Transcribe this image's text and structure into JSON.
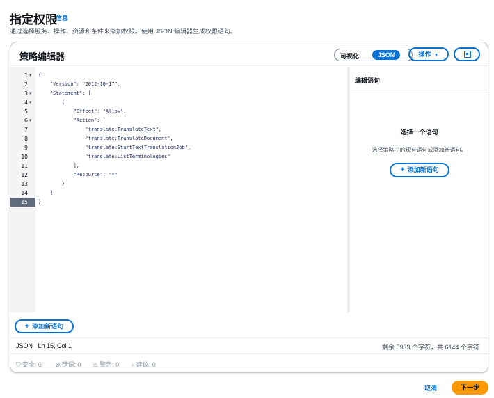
{
  "page": {
    "title": "指定权限",
    "info_link": "信息",
    "description": "通过选择服务、操作、资源和条件来添加权限。使用 JSON 编辑器生成权限语句。"
  },
  "editor_panel": {
    "title": "策略编辑器",
    "toggle": {
      "visual": "可视化",
      "json": "JSON",
      "selected": "JSON"
    },
    "actions_label": "操作",
    "actions_icon": "caret-down-icon",
    "panel_icon": "split-panel-icon"
  },
  "code": {
    "lines": [
      {
        "n": "1",
        "fold": "▼",
        "text": "{"
      },
      {
        "n": "2",
        "fold": "",
        "text": "    \"Version\": \"2012-10-17\","
      },
      {
        "n": "3",
        "fold": "▼",
        "text": "    \"Statement\": ["
      },
      {
        "n": "4",
        "fold": "▼",
        "text": "        {"
      },
      {
        "n": "5",
        "fold": "",
        "text": "            \"Effect\": \"Allow\","
      },
      {
        "n": "6",
        "fold": "▼",
        "text": "            \"Action\": ["
      },
      {
        "n": "7",
        "fold": "",
        "text": "                \"translate:TranslateText\","
      },
      {
        "n": "8",
        "fold": "",
        "text": "                \"translate:TranslateDocument\","
      },
      {
        "n": "9",
        "fold": "",
        "text": "                \"translate:StartTextTranslationJob\","
      },
      {
        "n": "10",
        "fold": "",
        "text": "                \"translate:ListTerminologies\""
      },
      {
        "n": "11",
        "fold": "",
        "text": "            ],"
      },
      {
        "n": "12",
        "fold": "",
        "text": "            \"Resource\": \"*\""
      },
      {
        "n": "13",
        "fold": "",
        "text": "        }"
      },
      {
        "n": "14",
        "fold": "",
        "text": "    ]"
      },
      {
        "n": "15",
        "fold": "",
        "text": "}"
      }
    ],
    "active_line": "15"
  },
  "side_panel": {
    "title": "编辑语句",
    "empty_title": "选择一个语句",
    "empty_desc": "选择策略中的现有语句或添加新语句。",
    "add_button": "添加新语句"
  },
  "add_statement_button": "添加新语句",
  "status_bar": {
    "left": "JSON   Ln 15, Col 1",
    "right": "剩余 5939 个字符，共 6144 个字符"
  },
  "lint": {
    "security": "安全: 0",
    "errors": "错误: 0",
    "warnings": "警告: 0",
    "suggestions": "建议: 0"
  },
  "footer": {
    "cancel": "取消",
    "next": "下一步"
  },
  "colors": {
    "accent": "#0972d3",
    "primary_button": "#ff9900",
    "text": "#0f141a"
  }
}
